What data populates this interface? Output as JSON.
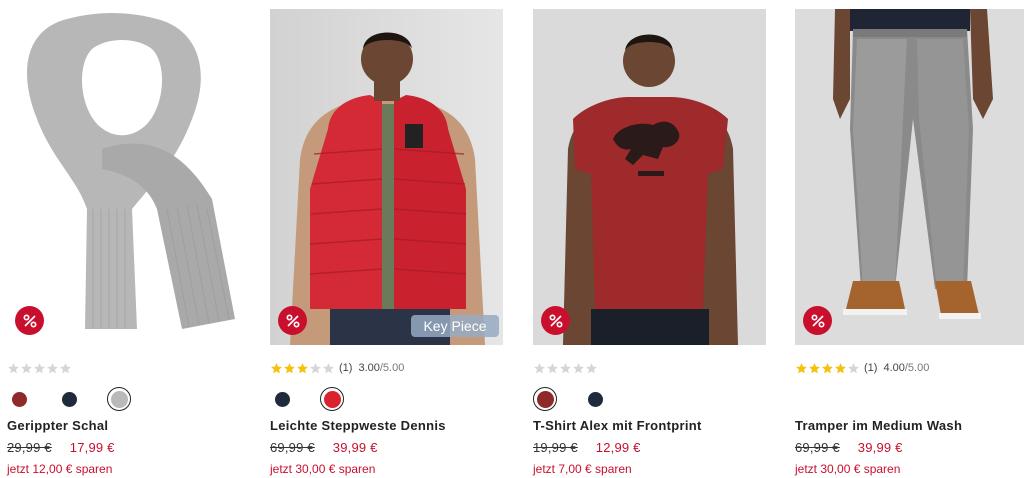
{
  "products": [
    {
      "name": "Gerippter Schal",
      "old_price": "29,99 €",
      "new_price": "17,99 €",
      "savings": "jetzt 12,00 € sparen",
      "rating": {
        "stars": 0,
        "count": "",
        "score": "",
        "max": ""
      },
      "key_piece": "",
      "swatches": [
        {
          "color": "#8e2a2a",
          "selected": false
        },
        {
          "color": "#1f2a3c",
          "selected": false
        },
        {
          "color": "#b9b9b9",
          "selected": true
        }
      ]
    },
    {
      "name": "Leichte Steppweste Dennis",
      "old_price": "69,99 €",
      "new_price": "39,99 €",
      "savings": "jetzt 30,00 € sparen",
      "rating": {
        "stars": 3,
        "count": "(1)",
        "score": "3.00",
        "max": "/5.00"
      },
      "key_piece": "Key Piece",
      "swatches": [
        {
          "color": "#1f2a3c",
          "selected": false
        },
        {
          "color": "#d9232e",
          "selected": true
        }
      ]
    },
    {
      "name": "T-Shirt Alex mit Frontprint",
      "old_price": "19,99 €",
      "new_price": "12,99 €",
      "savings": "jetzt 7,00 € sparen",
      "rating": {
        "stars": 0,
        "count": "",
        "score": "",
        "max": ""
      },
      "key_piece": "",
      "swatches": [
        {
          "color": "#8e2a2a",
          "selected": true
        },
        {
          "color": "#1f2a3c",
          "selected": false
        }
      ]
    },
    {
      "name": "Tramper im Medium Wash",
      "old_price": "69,99 €",
      "new_price": "39,99 €",
      "savings": "jetzt 30,00 € sparen",
      "rating": {
        "stars": 4,
        "count": "(1)",
        "score": "4.00",
        "max": "/5.00"
      },
      "key_piece": "",
      "swatches": []
    }
  ],
  "colors": {
    "sale_red": "#c8102e",
    "star_yellow": "#f4c20d",
    "star_empty": "#d6d6d6"
  },
  "icons": {
    "sale_badge": "percent-icon",
    "rating": "star-icon"
  }
}
